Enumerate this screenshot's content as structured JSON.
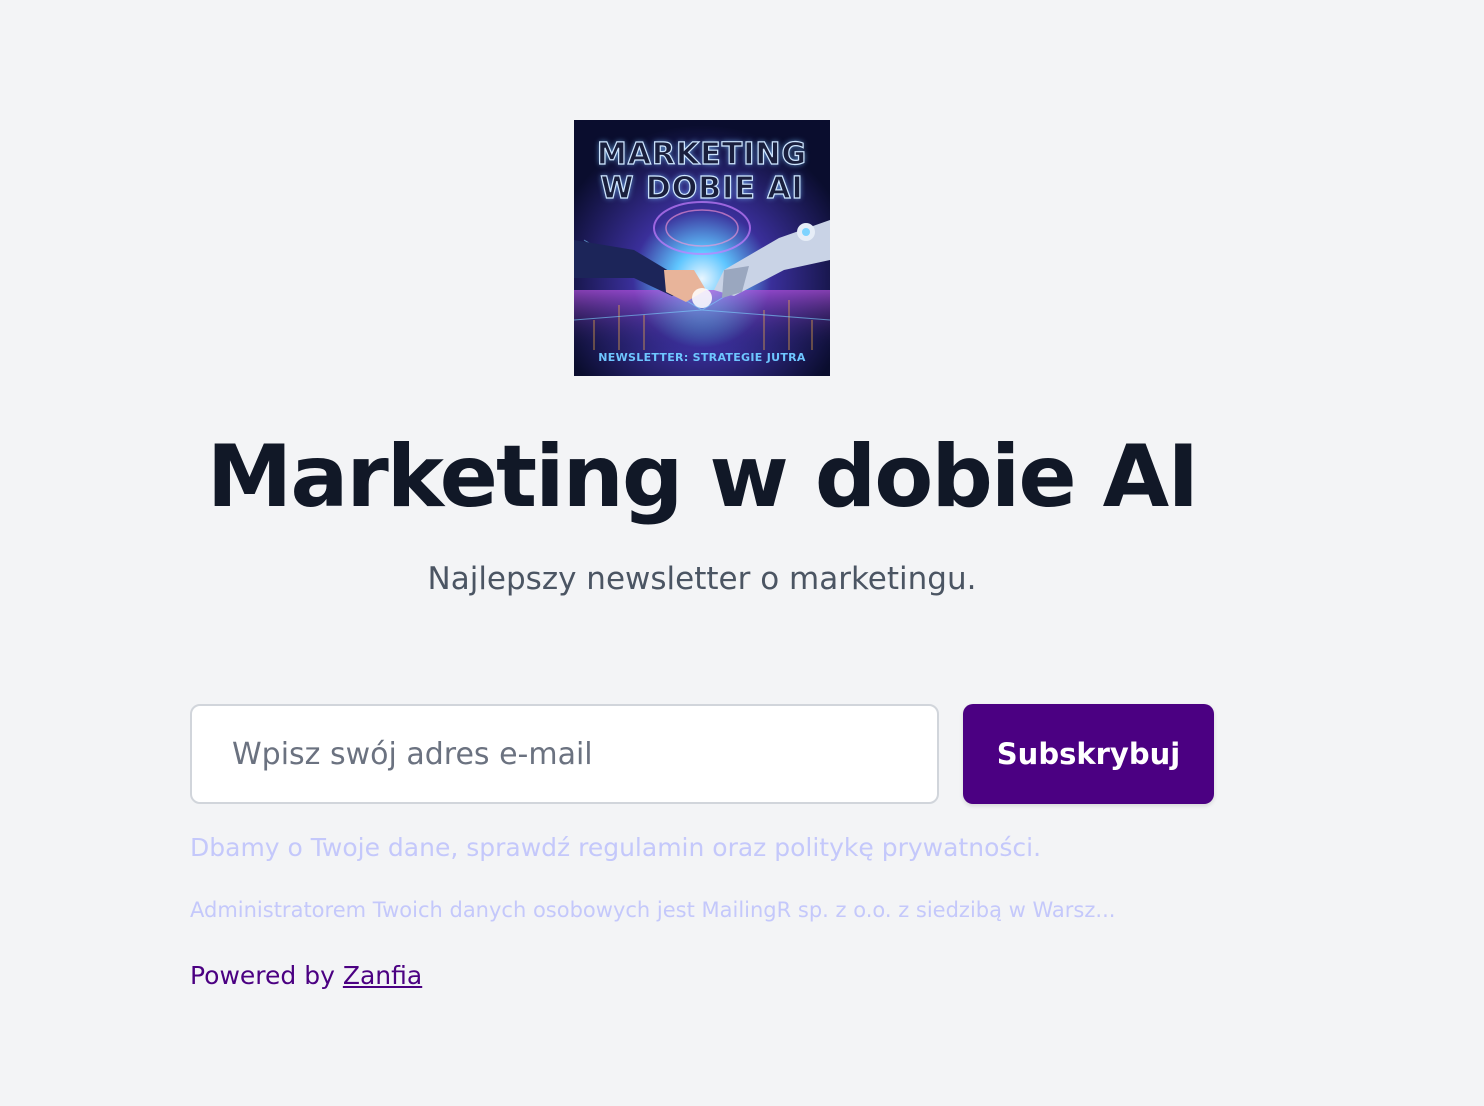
{
  "cover": {
    "title": "MARKETING W DOBIE AI",
    "subtitle": "NEWSLETTER: STRATEGIE JUTRA",
    "alt": "Marketing w dobie AI cover art"
  },
  "header": {
    "title": "Marketing w dobie AI",
    "subtitle": "Najlepszy newsletter o marketingu."
  },
  "form": {
    "email_placeholder": "Wpisz swój adres e-mail",
    "email_value": "",
    "submit_label": "Subskrybuj"
  },
  "legal": {
    "privacy_note": "Dbamy o Twoje dane, sprawdź regulamin oraz politykę prywatności.",
    "admin_note": "Administratorem Twoich danych osobowych jest MailingR sp. z o.o. z siedzibą w Warsz..."
  },
  "footer": {
    "powered_prefix": "Powered by",
    "powered_link": "Zanfia"
  },
  "colors": {
    "background": "#f3f4f6",
    "brand": "#4b0082",
    "heading": "#111827",
    "muted": "#4b5563",
    "legal": "#c4c8fb"
  }
}
